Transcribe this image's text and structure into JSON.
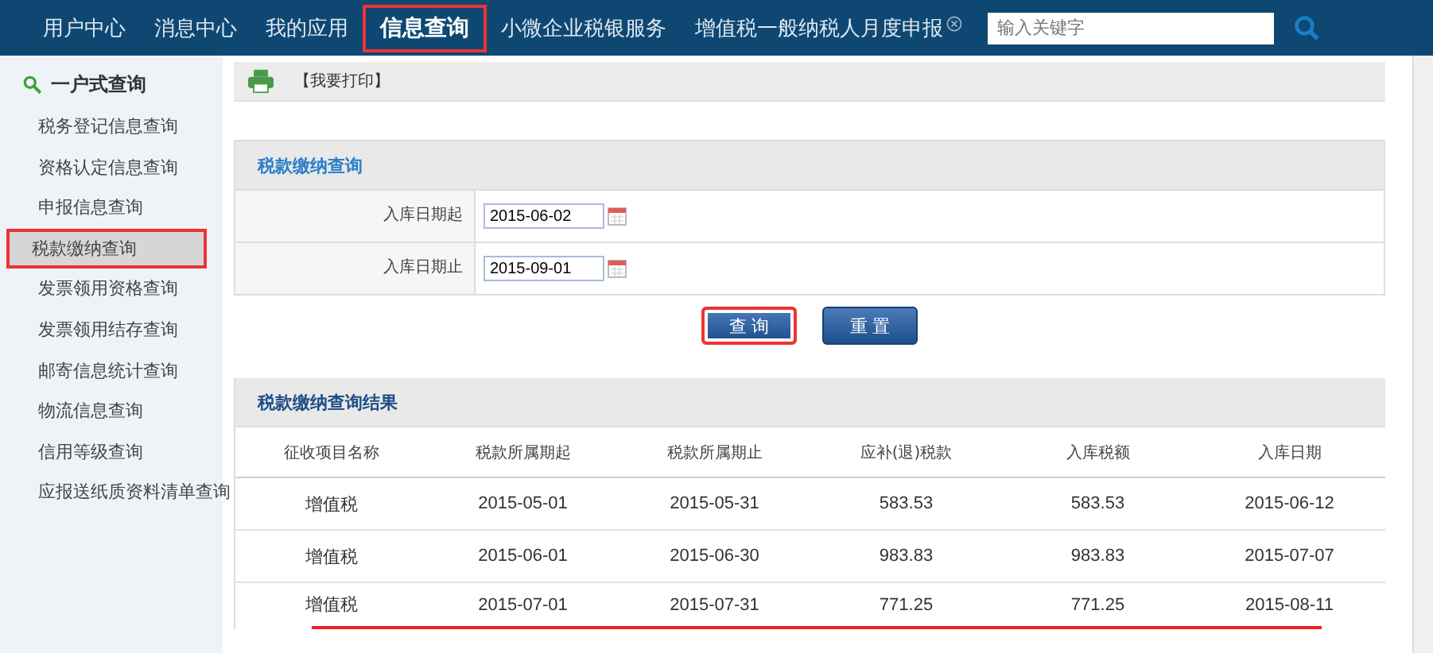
{
  "nav": {
    "tabs": [
      {
        "label": "用户中心",
        "selected": false,
        "highlighted": false,
        "closable": false
      },
      {
        "label": "消息中心",
        "selected": false,
        "highlighted": false,
        "closable": false
      },
      {
        "label": "我的应用",
        "selected": false,
        "highlighted": false,
        "closable": false
      },
      {
        "label": "信息查询",
        "selected": true,
        "highlighted": true,
        "closable": false
      },
      {
        "label": "小微企业税银服务",
        "selected": false,
        "highlighted": false,
        "closable": false
      },
      {
        "label": "增值税一般纳税人月度申报",
        "selected": false,
        "highlighted": false,
        "closable": true
      }
    ],
    "search": {
      "placeholder": "输入关键字"
    }
  },
  "sidebar": {
    "title": "一户式查询",
    "items": [
      {
        "label": "税务登记信息查询",
        "selected": false,
        "highlighted": false
      },
      {
        "label": "资格认定信息查询",
        "selected": false,
        "highlighted": false
      },
      {
        "label": "申报信息查询",
        "selected": false,
        "highlighted": false
      },
      {
        "label": "税款缴纳查询",
        "selected": true,
        "highlighted": true
      },
      {
        "label": "发票领用资格查询",
        "selected": false,
        "highlighted": false
      },
      {
        "label": "发票领用结存查询",
        "selected": false,
        "highlighted": false
      },
      {
        "label": "邮寄信息统计查询",
        "selected": false,
        "highlighted": false
      },
      {
        "label": "物流信息查询",
        "selected": false,
        "highlighted": false
      },
      {
        "label": "信用等级查询",
        "selected": false,
        "highlighted": false
      },
      {
        "label": "应报送纸质资料清单查询",
        "selected": false,
        "highlighted": false
      }
    ]
  },
  "print_bar": {
    "label": "【我要打印】"
  },
  "query": {
    "title": "税款缴纳查询",
    "fields": [
      {
        "label": "入库日期起",
        "value": "2015-06-02"
      },
      {
        "label": "入库日期止",
        "value": "2015-09-01"
      }
    ],
    "buttons": [
      {
        "label": "查 询",
        "highlighted": true
      },
      {
        "label": "重 置",
        "highlighted": false
      }
    ]
  },
  "results": {
    "title": "税款缴纳查询结果",
    "columns": [
      "征收项目名称",
      "税款所属期起",
      "税款所属期止",
      "应补(退)税款",
      "入库税额",
      "入库日期"
    ],
    "rows": [
      {
        "cells": [
          "增值税",
          "2015-05-01",
          "2015-05-31",
          "583.53",
          "583.53",
          "2015-06-12"
        ],
        "underlined": false
      },
      {
        "cells": [
          "增值税",
          "2015-06-01",
          "2015-06-30",
          "983.83",
          "983.83",
          "2015-07-07"
        ],
        "underlined": false
      },
      {
        "cells": [
          "增值税",
          "2015-07-01",
          "2015-07-31",
          "771.25",
          "771.25",
          "2015-08-11"
        ],
        "underlined": true
      }
    ]
  }
}
